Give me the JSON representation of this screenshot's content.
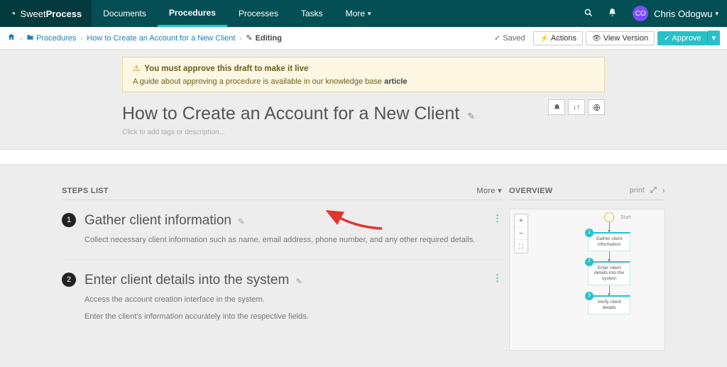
{
  "brand": {
    "name_light": "Sweet",
    "name_bold": "Process"
  },
  "nav": {
    "items": [
      "Documents",
      "Procedures",
      "Processes",
      "Tasks",
      "More"
    ],
    "active": "Procedures"
  },
  "user": {
    "initials": "CO",
    "name": "Chris Odogwu"
  },
  "breadcrumb": {
    "items": [
      "Procedures",
      "How to Create an Account for a New Client"
    ],
    "status": "Editing"
  },
  "toolbar": {
    "saved": "Saved",
    "actions": "Actions",
    "view_version": "View Version",
    "approve": "Approve"
  },
  "alert": {
    "title": "You must approve this draft to make it live",
    "subtitle_pre": "A guide about approving a procedure is available in our knowledge base ",
    "subtitle_link": "article"
  },
  "page": {
    "title": "How to Create an Account for a New Client",
    "placeholder": "Click to add tags or description..."
  },
  "steps_header": {
    "label": "STEPS LIST",
    "more": "More"
  },
  "steps": [
    {
      "num": "1",
      "title": "Gather client information",
      "desc": "Collect necessary client information such as name, email address, phone number, and any other required details."
    },
    {
      "num": "2",
      "title": "Enter client details into the system",
      "desc": "Access the account creation interface in the system.",
      "desc2": "Enter the client's information accurately into the respective fields."
    }
  ],
  "overview": {
    "label": "OVERVIEW",
    "print": "print",
    "start": "Start",
    "nodes": [
      {
        "n": "1",
        "label": "Gather client information"
      },
      {
        "n": "2",
        "label": "Enter client details into the system"
      },
      {
        "n": "3",
        "label": "Verify client details"
      }
    ]
  }
}
